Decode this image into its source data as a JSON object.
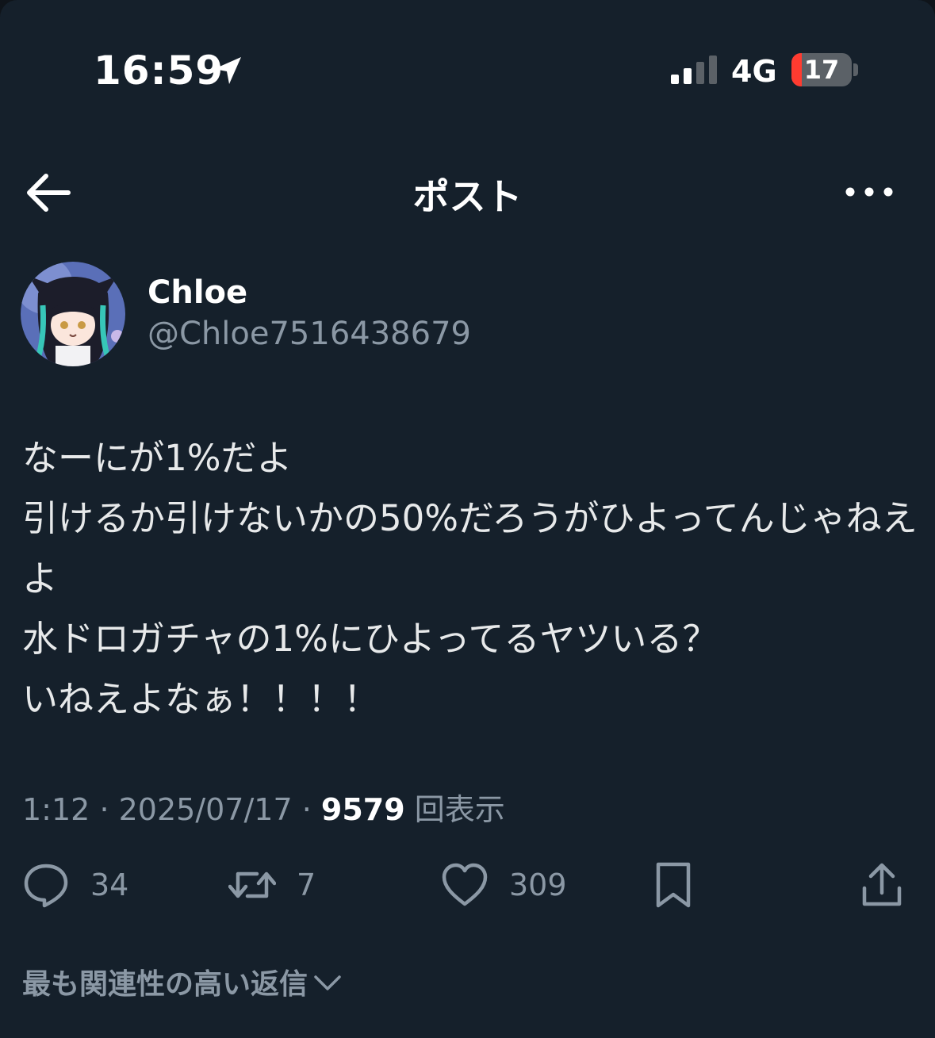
{
  "status_bar": {
    "time": "16:59",
    "network": "4G",
    "battery": "17",
    "battery_level": 0.17
  },
  "header": {
    "title": "ポスト"
  },
  "author": {
    "name": "Chloe",
    "handle": "@Chloe7516438679"
  },
  "post": {
    "text": "なーにが1%だよ\n引けるか引けないかの50%だろうがひよってんじゃねえよ\n水ドロガチャの1%にひよってるヤツいる？\nいねえよなぁ！！！！",
    "time": "1:12",
    "date": "2025/07/17",
    "views": "9579",
    "views_label": "回表示"
  },
  "actions": {
    "replies": "34",
    "reposts": "7",
    "likes": "309"
  },
  "replies_sort": {
    "label": "最も関連性の高い返信"
  },
  "colors": {
    "background": "#15202b",
    "text": "#e7e9ea",
    "secondary": "#8b98a5",
    "battery_low": "#ff3b30"
  },
  "icons": [
    "location-arrow-icon",
    "signal-icon",
    "battery-icon",
    "back-arrow-icon",
    "more-icon",
    "reply-icon",
    "repost-icon",
    "like-icon",
    "bookmark-icon",
    "share-icon",
    "chevron-down-icon"
  ]
}
